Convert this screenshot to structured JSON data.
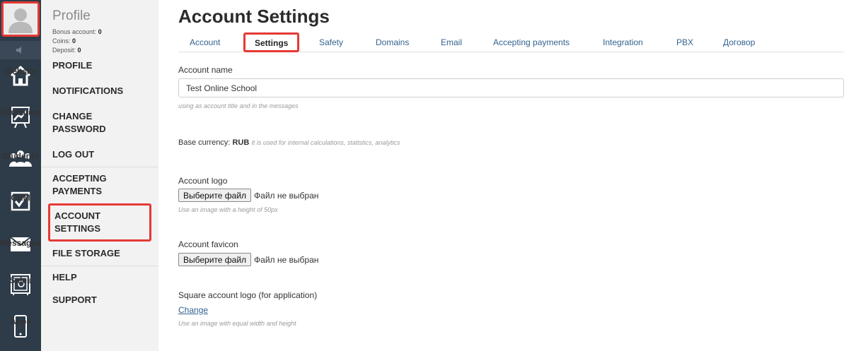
{
  "rail": {
    "items": [
      {
        "label": "Website",
        "icon": "house-icon"
      },
      {
        "label": "Education",
        "icon": "chart-board-icon"
      },
      {
        "label": "Students",
        "icon": "people-icon"
      },
      {
        "label": "CRM",
        "icon": "checkbox-icon"
      },
      {
        "label": "Messages",
        "icon": "envelope-icon"
      },
      {
        "label": "Sales",
        "icon": "safe-icon"
      },
      {
        "label": "Apps",
        "icon": "phone-icon"
      }
    ]
  },
  "profile": {
    "title": "Profile",
    "bonus_label": "Bonus account:",
    "bonus_value": "0",
    "coins_label": "Coins:",
    "coins_value": "0",
    "deposit_label": "Deposit:",
    "deposit_value": "0",
    "menu": [
      "PROFILE",
      "NOTIFICATIONS",
      "CHANGE PASSWORD",
      "LOG OUT",
      "ACCEPTING PAYMENTS",
      "ACCOUNT SETTINGS",
      "FILE STORAGE",
      "HELP",
      "SUPPORT"
    ]
  },
  "main": {
    "title": "Account Settings",
    "tabs": [
      "Account",
      "Settings",
      "Safety",
      "Domains",
      "Email",
      "Accepting payments",
      "Integration",
      "PBX",
      "Договор"
    ],
    "active_tab": "Settings",
    "account_name": {
      "label": "Account name",
      "value": "Test Online School",
      "hint": "using as account title and in the messages"
    },
    "currency": {
      "label": "Base currency:",
      "value": "RUB",
      "hint": "It is used for internal calculations, statistics, analytics"
    },
    "logo": {
      "label": "Account logo",
      "button": "Выберите файл",
      "status": "Файл не выбран",
      "hint": "Use an image with a height of 50px"
    },
    "favicon": {
      "label": "Account favicon",
      "button": "Выберите файл",
      "status": "Файл не выбран"
    },
    "square_logo": {
      "label": "Square account logo (for application)",
      "link": "Change",
      "hint": "Use an image with equal width and height"
    }
  },
  "colors": {
    "rail_bg": "#2e3b49",
    "highlight": "#e53935",
    "link": "#34628f"
  }
}
